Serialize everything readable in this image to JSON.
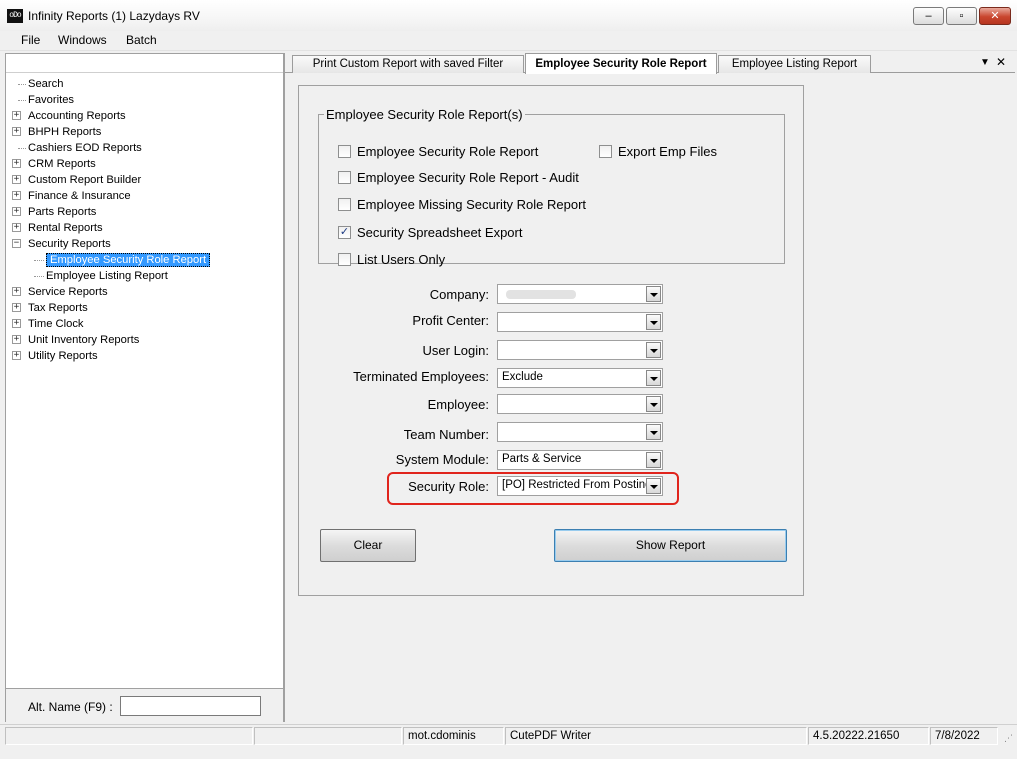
{
  "window": {
    "title": "Infinity Reports (1) Lazydays RV",
    "icon_text": "oDo",
    "minimize": "–",
    "maximize": "▫",
    "close": "✕"
  },
  "menu": [
    "File",
    "Windows",
    "Batch"
  ],
  "tree": [
    {
      "label": "Search",
      "expandable": false
    },
    {
      "label": "Favorites",
      "expandable": false
    },
    {
      "label": "Accounting Reports",
      "expandable": true
    },
    {
      "label": "BHPH Reports",
      "expandable": true
    },
    {
      "label": "Cashiers EOD Reports",
      "expandable": false
    },
    {
      "label": "CRM Reports",
      "expandable": true
    },
    {
      "label": "Custom Report Builder",
      "expandable": true
    },
    {
      "label": "Finance & Insurance",
      "expandable": true
    },
    {
      "label": "Parts Reports",
      "expandable": true
    },
    {
      "label": "Rental Reports",
      "expandable": true
    },
    {
      "label": "Security Reports",
      "expandable": true,
      "expanded": true
    },
    {
      "label": "Employee Security Role Report",
      "child": true,
      "selected": true
    },
    {
      "label": "Employee Listing Report",
      "child": true
    },
    {
      "label": "Service Reports",
      "expandable": true
    },
    {
      "label": "Tax Reports",
      "expandable": true
    },
    {
      "label": "Time Clock",
      "expandable": true
    },
    {
      "label": "Unit Inventory Reports",
      "expandable": true
    },
    {
      "label": "Utility Reports",
      "expandable": true
    }
  ],
  "alt_name": {
    "label": "Alt. Name (F9) :",
    "value": ""
  },
  "tabs": [
    {
      "label": "Print Custom Report with saved Filter",
      "active": false
    },
    {
      "label": "Employee Security Role Report",
      "active": true
    },
    {
      "label": "Employee Listing Report",
      "active": false
    }
  ],
  "tab_controls": {
    "dropdown": "▼",
    "close": "✕"
  },
  "report_group": {
    "title": "Employee Security Role Report(s)",
    "checkboxes": [
      {
        "label": "Employee Security Role Report",
        "checked": false
      },
      {
        "label": "Export Emp Files",
        "checked": false
      },
      {
        "label": "Employee Security Role Report - Audit",
        "checked": false
      },
      {
        "label": "Employee Missing Security Role Report",
        "checked": false
      },
      {
        "label": "Security Spreadsheet Export",
        "checked": true
      },
      {
        "label": "List Users Only",
        "checked": false
      }
    ]
  },
  "filters": [
    {
      "label": "Company:",
      "value": ""
    },
    {
      "label": "Profit Center:",
      "value": ""
    },
    {
      "label": "User Login:",
      "value": ""
    },
    {
      "label": "Terminated Employees:",
      "value": "Exclude"
    },
    {
      "label": "Employee:",
      "value": ""
    },
    {
      "label": "Team Number:",
      "value": ""
    },
    {
      "label": "System Module:",
      "value": "Parts & Service"
    },
    {
      "label": "Security Role:",
      "value": "[PO] Restricted From Posting"
    }
  ],
  "buttons": {
    "clear": "Clear",
    "show_report": "Show Report"
  },
  "status": {
    "user": "mot.cdominis",
    "printer": "CutePDF Writer",
    "version": "4.5.20222.21650",
    "date": "7/8/2022"
  }
}
